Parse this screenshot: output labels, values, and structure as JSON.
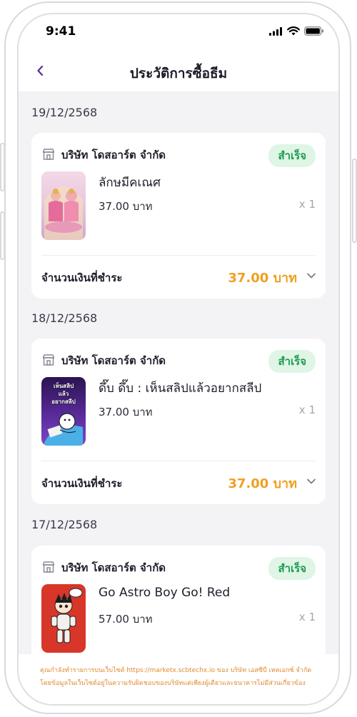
{
  "status_bar": {
    "time": "9:41"
  },
  "header": {
    "title": "ประวัติการซื้อธีม"
  },
  "groups": [
    {
      "date": "19/12/2568",
      "store": "บริษัท โดสอาร์ต จำกัด",
      "status": "สำเร็จ",
      "product": {
        "name": "ลักษมีคเณศ",
        "price": "37.00 บาท",
        "qty": "x 1",
        "thumb": "ganesha-lakshmi-thumbnail"
      },
      "total_label": "จำนวนเงินที่ชำระ",
      "total": "37.00 บาท"
    },
    {
      "date": "18/12/2568",
      "store": "บริษัท โดสอาร์ต จำกัด",
      "status": "สำเร็จ",
      "product": {
        "name": "ดึ๊บ ดึ๊บ : เห็นสลิปแล้วอยากสลีป",
        "price": "37.00 บาท",
        "qty": "x 1",
        "thumb": "cartoon-sleep-thumbnail",
        "thumb_text": [
          "เห็นสลิป",
          "แล้ว",
          "อยากสลีป"
        ]
      },
      "total_label": "จำนวนเงินที่ชำระ",
      "total": "37.00 บาท"
    },
    {
      "date": "17/12/2568",
      "store": "บริษัท โดสอาร์ต จำกัด",
      "status": "สำเร็จ",
      "product": {
        "name": "Go Astro Boy Go! Red",
        "price": "57.00 บาท",
        "qty": "x 1",
        "thumb": "astro-boy-red-thumbnail"
      }
    }
  ],
  "footer": {
    "line1": "คุณกำลังทำรายการบนเว็บไซต์ https://marketx.scbtechx.io ของ บริษัท เอสซีบี เทคเอกซ์ จำกัด",
    "line2": "โดยข้อมูลในเว็บไซต์อยู่ในความรับผิดชอบของบริษัทแต่เพียงผู้เดียวและธนาคารไม่มีส่วนเกี่ยวข้อง"
  },
  "colors": {
    "accent": "#5b2d8e",
    "total": "#f0a020",
    "success_bg": "#dff5e6",
    "success_text": "#1e9a50",
    "disclaimer": "#e08a30"
  }
}
